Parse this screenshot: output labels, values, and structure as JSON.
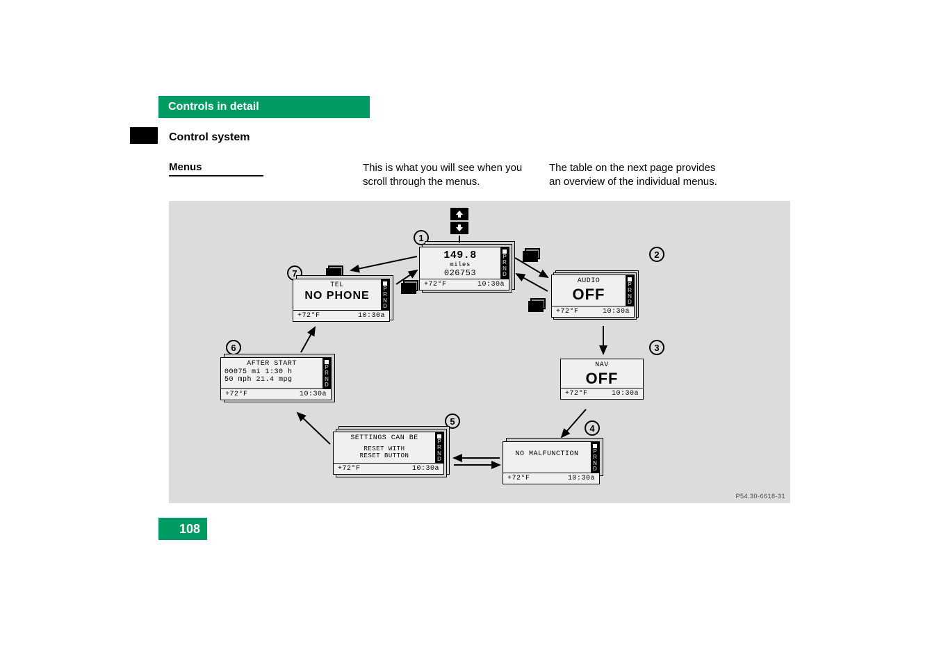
{
  "section": {
    "title": "Controls in detail",
    "subtitle": "Control system"
  },
  "menus_heading": "Menus",
  "columns": {
    "mid": "This is what you will see when you scroll through the menus.",
    "right": "The table on the next page provides an overview of the individual menus."
  },
  "figure_code": "P54.30-6618-31",
  "page_number": "108",
  "footer": {
    "temp": "+72°F",
    "time": "10:30a"
  },
  "prnd": [
    "P",
    "R",
    "N",
    "D"
  ],
  "screens": {
    "s1": {
      "title": "",
      "line1": "149.8",
      "line2": "miles",
      "line3": "026753"
    },
    "s2": {
      "title": "AUDIO",
      "big": "OFF"
    },
    "s3": {
      "title": "NAV",
      "big": "OFF"
    },
    "s4": {
      "line": "NO MALFUNCTION"
    },
    "s5": {
      "title": "SETTINGS CAN BE",
      "line1": "RESET WITH",
      "line2": "RESET BUTTON"
    },
    "s6": {
      "title": "AFTER START",
      "line1": "00075 mi  1:30 h",
      "line2": "50 mph  21.4 mpg"
    },
    "s7": {
      "title": "TEL",
      "line": "NO PHONE"
    }
  },
  "callouts": {
    "c1": "1",
    "c2": "2",
    "c3": "3",
    "c4": "4",
    "c5": "5",
    "c6": "6",
    "c7": "7"
  }
}
